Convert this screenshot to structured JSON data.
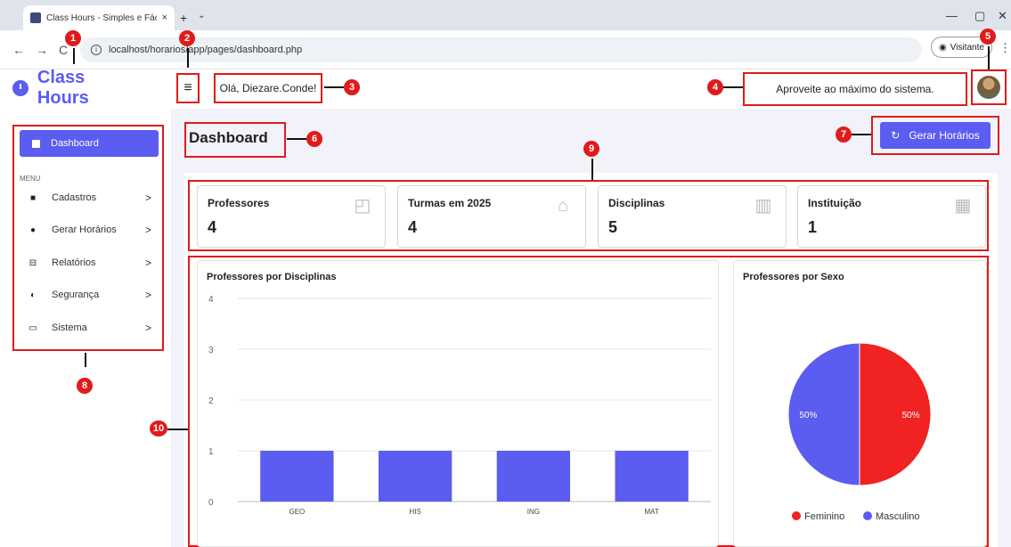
{
  "browser": {
    "tab_title": "Class Hours - Simples e Fácil de",
    "tab_close": "×",
    "new_tab": "+",
    "tab_dropdown": "⌄",
    "url": "localhost/horarios/app/pages/dashboard.php",
    "profile_label": "Visitante",
    "back": "←",
    "forward": "→",
    "reload": "C",
    "minimize": "—",
    "restore": "▢",
    "close": "✕",
    "menu": "⋮"
  },
  "brand": {
    "name": "Class Hours",
    "icon": "clock-icon"
  },
  "header": {
    "menu_toggle": "≡",
    "greeting": "Olá, Diezare.Conde!",
    "tagline": "Aproveite ao máximo do sistema."
  },
  "sidebar": {
    "active_item": "Dashboard",
    "menu_heading": "MENU",
    "items": [
      {
        "label": "Cadastros",
        "icon": "folder-icon"
      },
      {
        "label": "Gerar Horários",
        "icon": "clock-icon"
      },
      {
        "label": "Relatórios",
        "icon": "printer-icon"
      },
      {
        "label": "Segurança",
        "icon": "shield-icon"
      },
      {
        "label": "Sistema",
        "icon": "laptop-icon"
      }
    ],
    "chevron": ">"
  },
  "page": {
    "title": "Dashboard",
    "generate_button": "Gerar Horários"
  },
  "stats": [
    {
      "label": "Professores",
      "value": "4",
      "icon": "teacher-icon"
    },
    {
      "label": "Turmas em 2025",
      "value": "4",
      "icon": "school-icon"
    },
    {
      "label": "Disciplinas",
      "value": "5",
      "icon": "book-icon"
    },
    {
      "label": "Instituição",
      "value": "1",
      "icon": "building-icon"
    }
  ],
  "annotations": [
    "1",
    "2",
    "3",
    "4",
    "5",
    "6",
    "7",
    "8",
    "9",
    "10"
  ],
  "colors": {
    "accent": "#5b5cf0",
    "female": "#f02222",
    "annotation": "#e01b1b"
  },
  "chart_data": [
    {
      "type": "bar",
      "title": "Professores por Disciplinas",
      "categories": [
        "GEO",
        "HIS",
        "ING",
        "MAT"
      ],
      "values": [
        1,
        1,
        1,
        1
      ],
      "ylim": [
        0,
        4
      ],
      "yticks": [
        "0",
        "1",
        "2",
        "3",
        "4"
      ],
      "grid": true
    },
    {
      "type": "pie",
      "title": "Professores por Sexo",
      "labels": [
        "Feminino",
        "Masculino"
      ],
      "values": [
        50,
        50
      ],
      "value_labels": [
        "50%",
        "50%"
      ],
      "colors": [
        "#f02222",
        "#5b5cf0"
      ],
      "legend": "bottom"
    }
  ]
}
